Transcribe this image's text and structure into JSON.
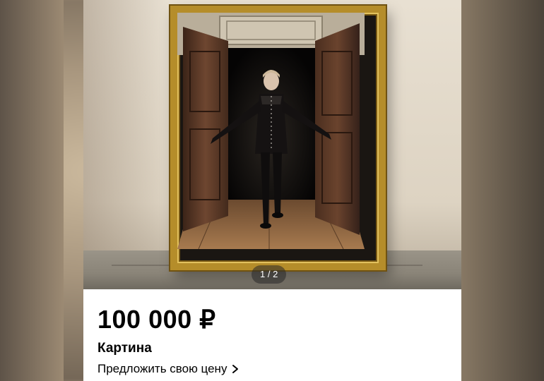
{
  "gallery": {
    "pager_text": "1 / 2"
  },
  "listing": {
    "price": "100 000 ₽",
    "title": "Картина",
    "offer_link": "Предложить свою цену",
    "offer_icon": "chevron-right-icon"
  },
  "colors": {
    "frame_gold": "#b58d2a",
    "card_background": "#ffffff",
    "text": "#000000"
  }
}
